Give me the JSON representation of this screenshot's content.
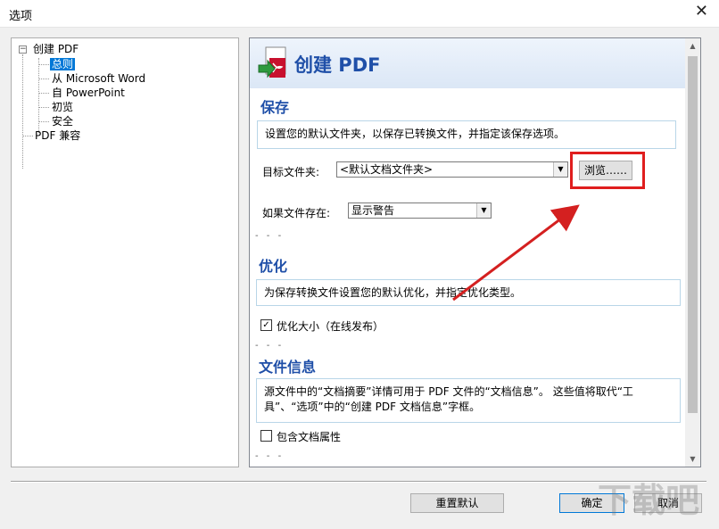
{
  "window": {
    "title": "选项",
    "close_glyph": "✕"
  },
  "tree": {
    "root": "创建 PDF",
    "children": [
      "总则",
      "从 Microsoft Word",
      "自 PowerPoint",
      "初览",
      "安全"
    ],
    "other": "PDF 兼容",
    "expander": "−"
  },
  "panel": {
    "title": "创建 PDF",
    "save": {
      "heading": "保存",
      "description": "设置您的默认文件夹，以保存已转换文件，并指定该保存选项。",
      "target_label": "目标文件夹:",
      "target_value": "<默认文档文件夹>",
      "browse_label": "浏览……",
      "if_exists_label": "如果文件存在:",
      "if_exists_value": "显示警告"
    },
    "optimize": {
      "heading": "优化",
      "description": "为保存转换文件设置您的默认优化，并指定优化类型。",
      "checkbox_label": "优化大小（在线发布）",
      "checked": true
    },
    "fileinfo": {
      "heading": "文件信息",
      "description": "源文件中的“文档摘要”详情可用于 PDF 文件的“文档信息”。 这些值将取代“工具”、“选项”中的“创建 PDF 文档信息”字框。",
      "checkbox_label": "包含文档属性",
      "checked": false
    },
    "section_dashes": "- - -"
  },
  "buttons": {
    "reset": "重置默认",
    "ok": "确定",
    "cancel": "取消"
  },
  "colors": {
    "accent": "#1f4fa8",
    "highlight": "#e01e1e",
    "selection": "#0078d7"
  },
  "watermark": "下载吧"
}
